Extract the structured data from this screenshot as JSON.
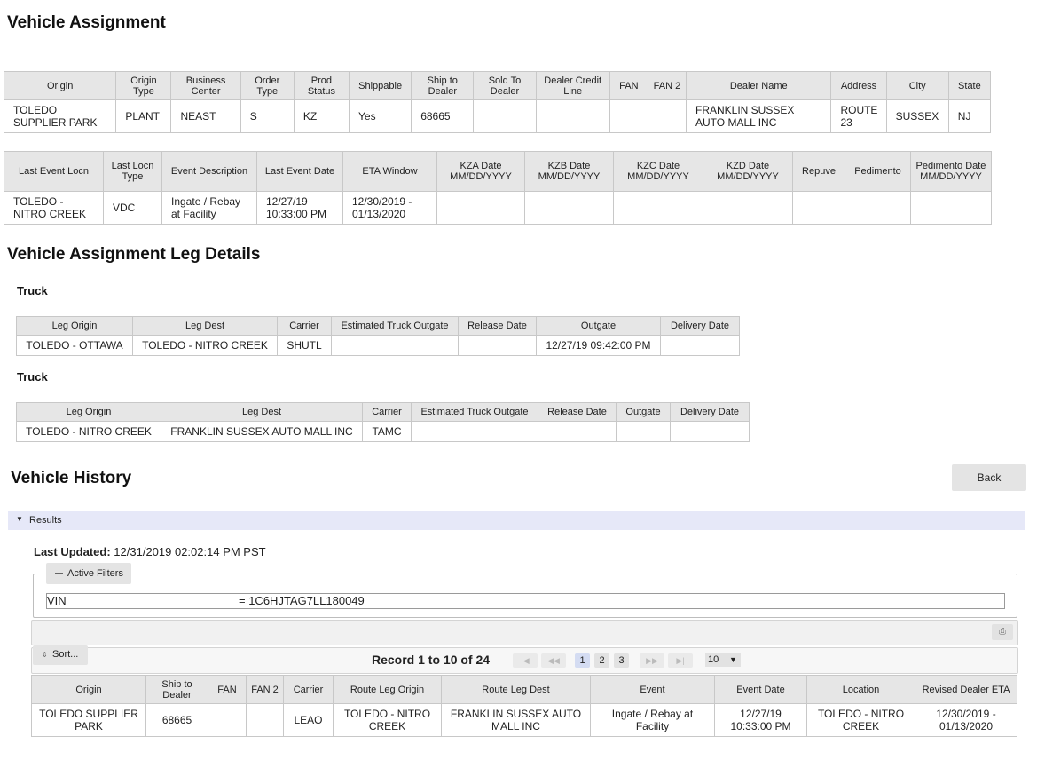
{
  "page": {
    "title": "Vehicle Assignment",
    "leg_title": "Vehicle Assignment Leg Details",
    "history_title": "Vehicle History",
    "back_label": "Back"
  },
  "assignment_table1": {
    "headers": [
      "Origin",
      "Origin Type",
      "Business Center",
      "Order Type",
      "Prod Status",
      "Shippable",
      "Ship to Dealer",
      "Sold To Dealer",
      "Dealer Credit Line",
      "FAN",
      "FAN 2",
      "Dealer Name",
      "Address",
      "City",
      "State"
    ],
    "row": [
      "TOLEDO SUPPLIER PARK",
      "PLANT",
      "NEAST",
      "S",
      "KZ",
      "Yes",
      "68665",
      "",
      "",
      "",
      "",
      "FRANKLIN SUSSEX AUTO MALL INC",
      "ROUTE 23",
      "SUSSEX",
      "NJ"
    ]
  },
  "assignment_table2": {
    "headers": [
      "Last Event Locn",
      "Last Locn Type",
      "Event Description",
      "Last Event Date",
      "ETA Window",
      "KZA Date MM/DD/YYYY",
      "KZB Date MM/DD/YYYY",
      "KZC Date MM/DD/YYYY",
      "KZD Date MM/DD/YYYY",
      "Repuve",
      "Pedimento",
      "Pedimento Date MM/DD/YYYY"
    ],
    "row": [
      "TOLEDO - NITRO CREEK",
      "VDC",
      "Ingate / Rebay at Facility",
      "12/27/19 10:33:00 PM",
      "12/30/2019 - 01/13/2020",
      "",
      "",
      "",
      "",
      "",
      "",
      ""
    ]
  },
  "legs": [
    {
      "label": "Truck",
      "headers": [
        "Leg Origin",
        "Leg Dest",
        "Carrier",
        "Estimated Truck Outgate",
        "Release Date",
        "Outgate",
        "Delivery Date"
      ],
      "row": [
        "TOLEDO - OTTAWA",
        "TOLEDO - NITRO CREEK",
        "SHUTL",
        "",
        "",
        "12/27/19 09:42:00 PM",
        ""
      ]
    },
    {
      "label": "Truck",
      "headers": [
        "Leg Origin",
        "Leg Dest",
        "Carrier",
        "Estimated Truck Outgate",
        "Release Date",
        "Outgate",
        "Delivery Date"
      ],
      "row": [
        "TOLEDO - NITRO CREEK",
        "FRANKLIN SUSSEX AUTO MALL INC",
        "TAMC",
        "",
        "",
        "",
        ""
      ]
    }
  ],
  "history": {
    "results_label": "Results",
    "last_updated_label": "Last Updated:",
    "last_updated_value": "12/31/2019 02:02:14 PM PST",
    "active_filters_label": "Active Filters",
    "filter_key": "VIN",
    "filter_value": "= 1C6HJTAG7LL180049",
    "sort_label": "Sort...",
    "record_text": "Record 1 to 10 of 24",
    "pages": [
      "1",
      "2",
      "3"
    ],
    "page_size": "10",
    "nav": {
      "first": "|◀",
      "prev": "◀◀",
      "next": "▶▶",
      "last": "▶|"
    },
    "headers": [
      "Origin",
      "Ship to Dealer",
      "FAN",
      "FAN 2",
      "Carrier",
      "Route Leg Origin",
      "Route Leg Dest",
      "Event",
      "Event Date",
      "Location",
      "Revised Dealer ETA"
    ],
    "row": [
      "TOLEDO SUPPLIER PARK",
      "68665",
      "",
      "",
      "LEAO",
      "TOLEDO - NITRO CREEK",
      "FRANKLIN SUSSEX AUTO MALL INC",
      "Ingate / Rebay at Facility",
      "12/27/19 10:33:00 PM",
      "TOLEDO - NITRO CREEK",
      "12/30/2019 - 01/13/2020"
    ]
  }
}
